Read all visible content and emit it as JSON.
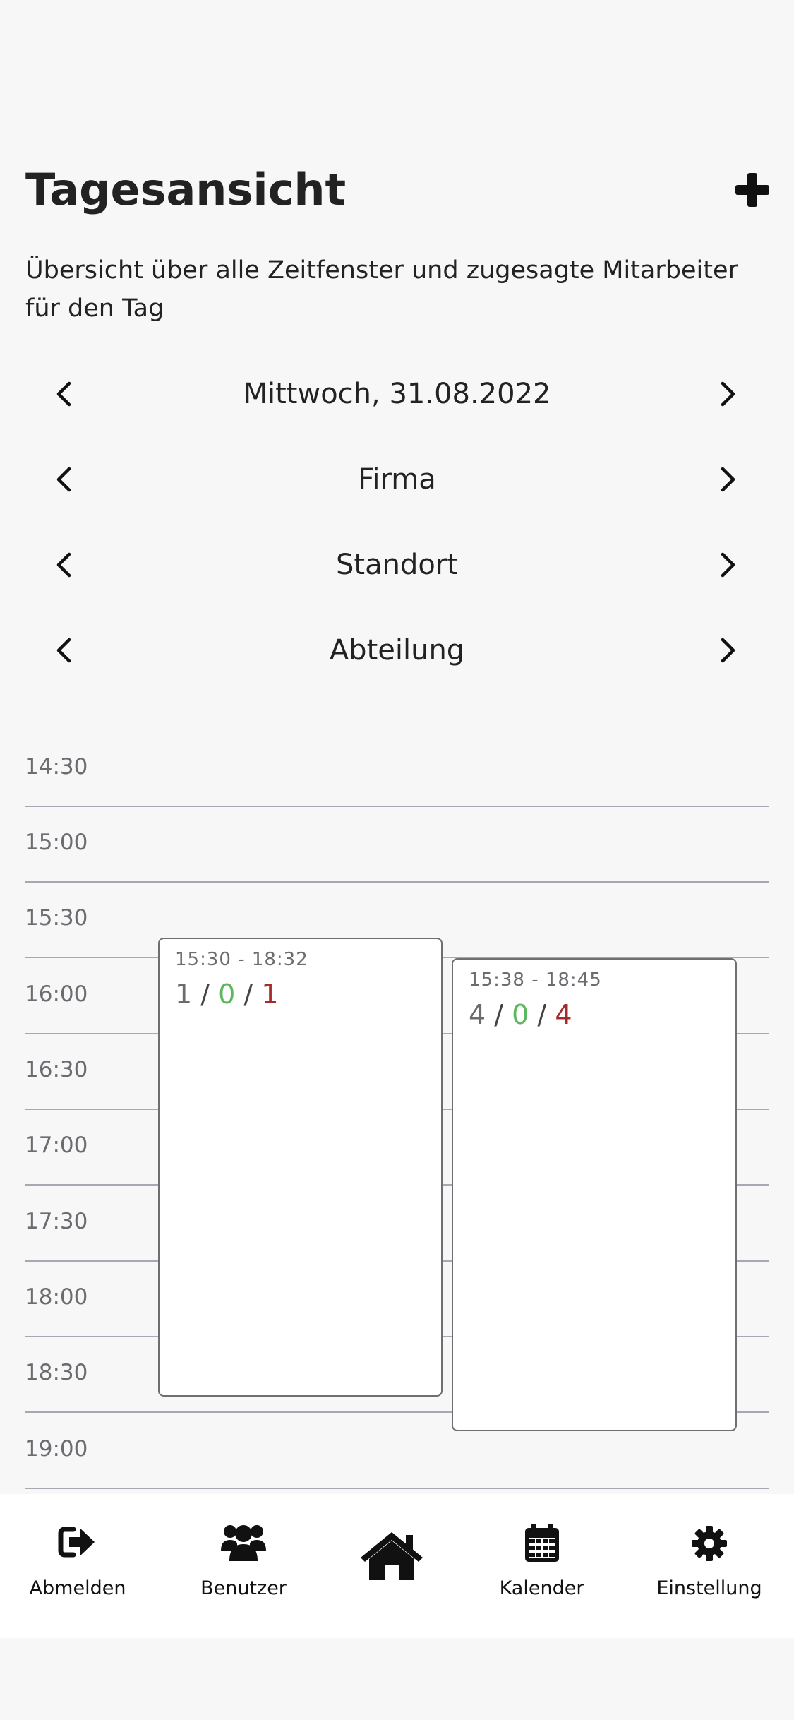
{
  "header": {
    "title": "Tagesansicht",
    "add_icon": "plus-icon",
    "subtitle": "Übersicht über alle Zeitfenster und zugesagte Mitarbeiter für den Tag"
  },
  "selectors": {
    "date": "Mittwoch, 31.08.2022",
    "company": "Firma",
    "location": "Standort",
    "department": "Abteilung"
  },
  "timeline": {
    "slots": [
      "14:30",
      "15:00",
      "15:30",
      "16:00",
      "16:30",
      "17:00",
      "17:30",
      "18:00",
      "18:30",
      "19:00"
    ]
  },
  "events": [
    {
      "time": "15:30 - 18:32",
      "total": "1",
      "accepted": "0",
      "open": "1"
    },
    {
      "time": "15:38 - 18:45",
      "total": "4",
      "accepted": "0",
      "open": "4"
    }
  ],
  "nav": {
    "logout": "Abmelden",
    "users": "Benutzer",
    "calendar": "Kalender",
    "settings": "Einstellung"
  },
  "colors": {
    "accepted": "#5cb85c",
    "open": "#a52a2a",
    "total": "#6b6b70"
  }
}
